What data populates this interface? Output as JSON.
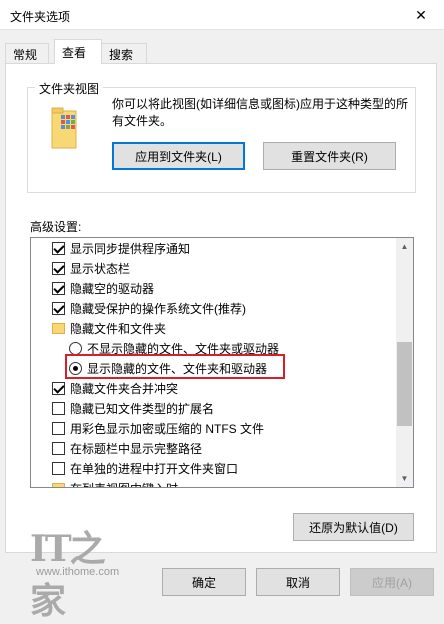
{
  "window": {
    "title": "文件夹选项",
    "close_glyph": "✕"
  },
  "tabs": [
    {
      "label": "常规"
    },
    {
      "label": "查看",
      "active": true
    },
    {
      "label": "搜索"
    }
  ],
  "folder_view": {
    "title": "文件夹视图",
    "description": "你可以将此视图(如详细信息或图标)应用于这种类型的所有文件夹。",
    "apply_button": "应用到文件夹(L)",
    "reset_button": "重置文件夹(R)"
  },
  "advanced": {
    "label": "高级设置:",
    "items": [
      {
        "type": "checkbox",
        "checked": true,
        "label": "显示同步提供程序通知"
      },
      {
        "type": "checkbox",
        "checked": true,
        "label": "显示状态栏"
      },
      {
        "type": "checkbox",
        "checked": true,
        "label": "隐藏空的驱动器"
      },
      {
        "type": "checkbox",
        "checked": true,
        "label": "隐藏受保护的操作系统文件(推荐)"
      },
      {
        "type": "folder",
        "label": "隐藏文件和文件夹"
      },
      {
        "type": "radio",
        "selected": false,
        "label": "不显示隐藏的文件、文件夹或驱动器"
      },
      {
        "type": "radio",
        "selected": true,
        "label": "显示隐藏的文件、文件夹和驱动器"
      },
      {
        "type": "checkbox",
        "checked": true,
        "label": "隐藏文件夹合并冲突"
      },
      {
        "type": "checkbox",
        "checked": false,
        "label": "隐藏已知文件类型的扩展名"
      },
      {
        "type": "checkbox",
        "checked": false,
        "label": "用彩色显示加密或压缩的 NTFS 文件"
      },
      {
        "type": "checkbox",
        "checked": false,
        "label": "在标题栏中显示完整路径"
      },
      {
        "type": "checkbox",
        "checked": false,
        "label": "在单独的进程中打开文件夹窗口"
      },
      {
        "type": "folder",
        "label": "在列表视图中键入时"
      }
    ],
    "restore_button": "还原为默认值(D)"
  },
  "footer": {
    "ok": "确定",
    "cancel": "取消",
    "apply": "应用(A)"
  },
  "watermark": {
    "logo": "IT之家",
    "url": "www.ithome.com"
  },
  "colors": {
    "highlight": "#d81e28",
    "focus": "#0078d7"
  }
}
